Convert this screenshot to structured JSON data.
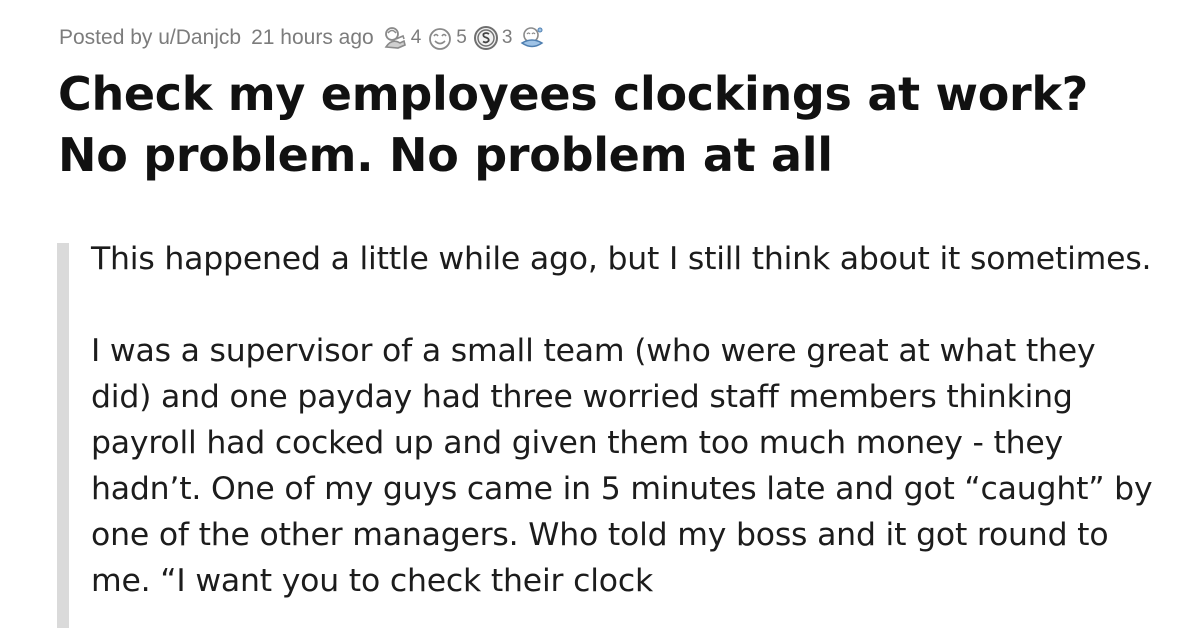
{
  "post": {
    "posted_by": "Posted by u/Danjcb",
    "time": "21 hours ago",
    "awards": [
      {
        "icon": "helpful-award-icon",
        "count": "4"
      },
      {
        "icon": "wholesome-award-icon",
        "count": "5"
      },
      {
        "icon": "silver-award-icon",
        "count": "3"
      },
      {
        "icon": "hugz-award-icon",
        "count": ""
      }
    ],
    "title": "Check my employees clockings at work? No problem. No problem at all",
    "paragraphs": [
      "This happened a little while ago, but I still think about it sometimes.",
      "I was a supervisor of a small team (who were great at what they did) and one payday had three worried staff members thinking payroll had cocked up and given them too much money - they hadn’t. One of my guys came in 5 minutes late and got “caught” by one of the other managers. Who told my boss and it got round to me. “I want you to check their clock"
    ]
  },
  "colors": {
    "meta_text": "#7c7c7c",
    "title_text": "#111111",
    "body_text": "#1c1c1c",
    "quote_bar": "#dadada"
  }
}
